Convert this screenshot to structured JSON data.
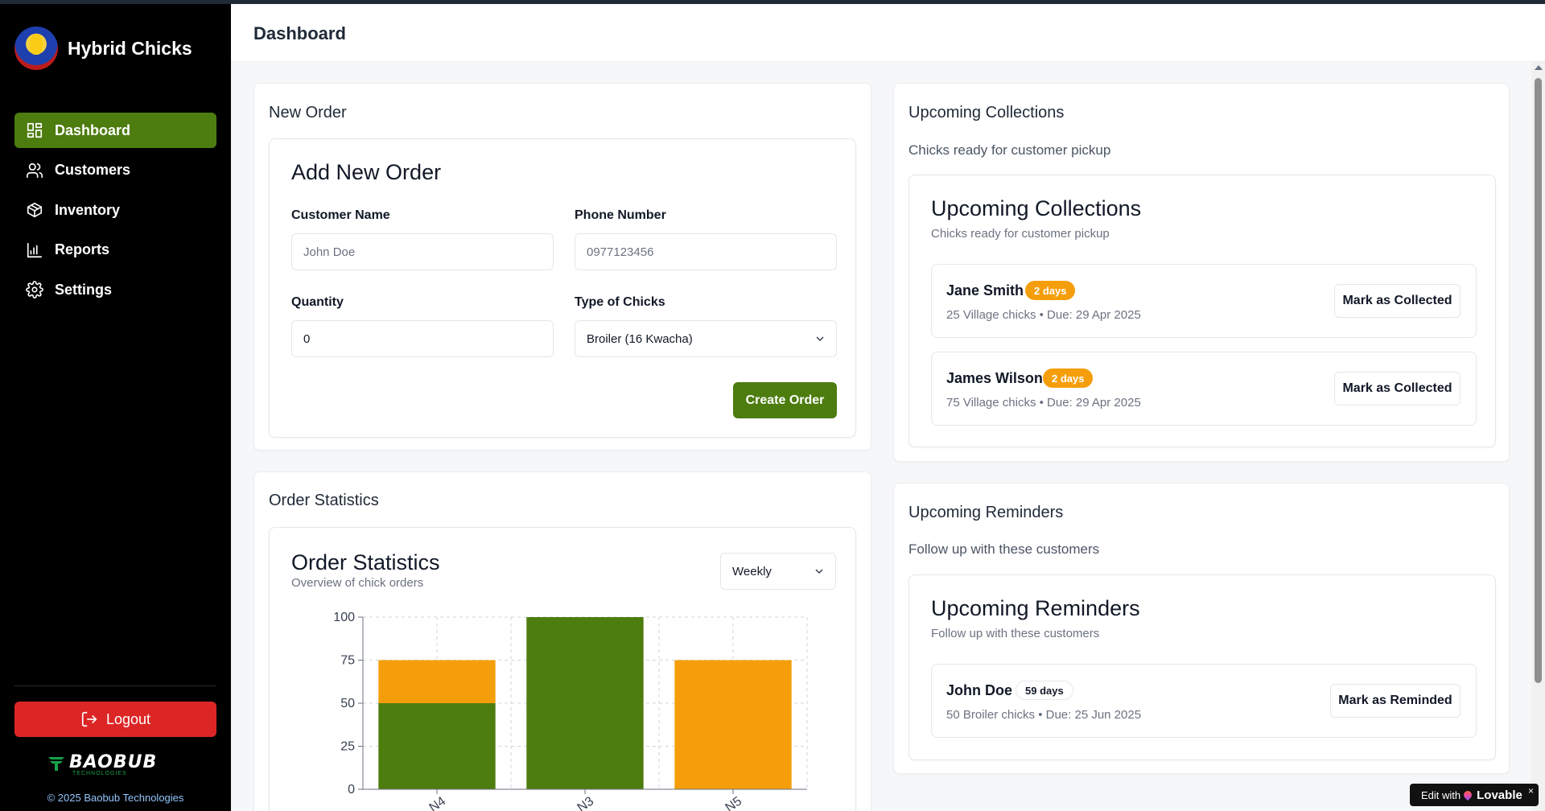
{
  "app": {
    "brand": "Hybrid Chicks",
    "page_title": "Dashboard"
  },
  "sidebar": {
    "items": [
      {
        "label": "Dashboard",
        "icon": "dashboard-grid-icon",
        "active": true
      },
      {
        "label": "Customers",
        "icon": "users-icon",
        "active": false
      },
      {
        "label": "Inventory",
        "icon": "package-icon",
        "active": false
      },
      {
        "label": "Reports",
        "icon": "bar-chart-icon",
        "active": false
      },
      {
        "label": "Settings",
        "icon": "gear-icon",
        "active": false
      }
    ],
    "logout_label": "Logout",
    "company_logo_text": "BAOBUB",
    "company_logo_sub": "TECHNOLOGIES",
    "copyright": "© 2025 Baobub Technologies"
  },
  "new_order": {
    "card_title": "New Order",
    "form_title": "Add New Order",
    "customer_name_label": "Customer Name",
    "customer_name_placeholder": "John Doe",
    "phone_label": "Phone Number",
    "phone_placeholder": "0977123456",
    "quantity_label": "Quantity",
    "quantity_value": "0",
    "type_label": "Type of Chicks",
    "type_value": "Broiler (16 Kwacha)",
    "submit_label": "Create Order"
  },
  "order_stats": {
    "card_title": "Order Statistics",
    "title": "Order Statistics",
    "subtitle": "Overview of chick orders",
    "period": "Weekly"
  },
  "chart_data": {
    "type": "bar",
    "stacked": true,
    "categories": [
      "N4",
      "N3",
      "N5"
    ],
    "series": [
      {
        "color": "#4d7c0f",
        "values": [
          50,
          100,
          0
        ]
      },
      {
        "color": "#f59e0b",
        "values": [
          25,
          0,
          75
        ]
      }
    ],
    "ylim": [
      0,
      100
    ],
    "yticks": [
      0,
      25,
      50,
      75,
      100
    ],
    "grid": true
  },
  "collections": {
    "card_title": "Upcoming Collections",
    "card_subtitle": "Chicks ready for customer pickup",
    "title": "Upcoming Collections",
    "subtitle": "Chicks ready for customer pickup",
    "items": [
      {
        "name": "Jane Smith",
        "badge": "2 days",
        "meta": "25 Village chicks  •  Due: 29 Apr 2025",
        "action": "Mark as Collected"
      },
      {
        "name": "James Wilson",
        "badge": "2 days",
        "meta": "75 Village chicks  •  Due: 29 Apr 2025",
        "action": "Mark as Collected"
      }
    ]
  },
  "reminders": {
    "card_title": "Upcoming Reminders",
    "card_subtitle": "Follow up with these customers",
    "title": "Upcoming Reminders",
    "subtitle": "Follow up with these customers",
    "items": [
      {
        "name": "John Doe",
        "badge": "59 days",
        "meta": "50 Broiler chicks  •  Due: 25 Jun 2025",
        "action": "Mark as Reminded"
      }
    ]
  },
  "lovable": {
    "edit_with": "Edit with",
    "brand": "Lovable",
    "close": "×"
  },
  "colors": {
    "accent_green": "#4d7c0f",
    "accent_orange": "#f59e0b",
    "logout_red": "#dc2626"
  }
}
